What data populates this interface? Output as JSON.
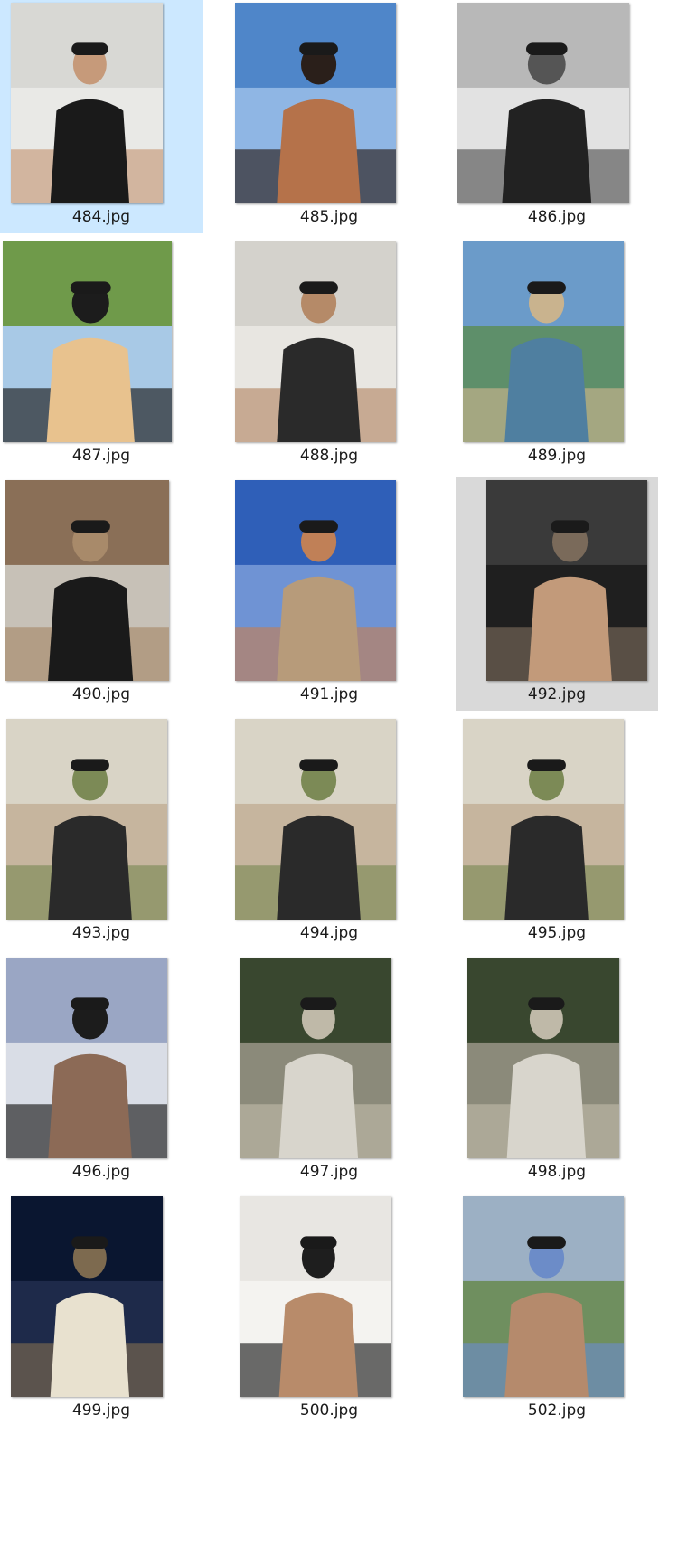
{
  "view": "large-icons",
  "selected_file": "484.jpg",
  "hovered_file": "492.jpg",
  "files": [
    {
      "name": "484.jpg",
      "scene": "mirror-selfie-black-tank",
      "palette": [
        "#d8d8d4",
        "#e9e9e6",
        "#1a1a1a",
        "#c69a7a"
      ]
    },
    {
      "name": "485.jpg",
      "scene": "shirtless-blue-sky",
      "palette": [
        "#4f86c9",
        "#8fb6e4",
        "#b5724a",
        "#2a1f1a"
      ]
    },
    {
      "name": "486.jpg",
      "scene": "bench-black-and-white",
      "palette": [
        "#b8b8b8",
        "#e2e2e2",
        "#222222",
        "#555555"
      ]
    },
    {
      "name": "487.jpg",
      "scene": "sunglasses-floral-shirt",
      "palette": [
        "#6f9a4a",
        "#a8c9e6",
        "#e8c28e",
        "#1c1c1c"
      ]
    },
    {
      "name": "488.jpg",
      "scene": "portrait-dark-blazer",
      "palette": [
        "#d4d2cc",
        "#e8e6e1",
        "#2a2a2a",
        "#b58a68"
      ]
    },
    {
      "name": "489.jpg",
      "scene": "retiro-park-lake",
      "palette": [
        "#6b9bc9",
        "#5e8f6a",
        "#4f7fa0",
        "#c9b38e"
      ]
    },
    {
      "name": "490.jpg",
      "scene": "mirror-selfie-chair",
      "palette": [
        "#8a6f57",
        "#c7c1b7",
        "#1a1a1a",
        "#a88a6a"
      ]
    },
    {
      "name": "491.jpg",
      "scene": "shirtless-desert-sky",
      "palette": [
        "#2f5fb8",
        "#6f93d4",
        "#b79b7a",
        "#c08057"
      ]
    },
    {
      "name": "492.jpg",
      "scene": "leather-jacket-portrait",
      "palette": [
        "#3a3a3a",
        "#1f1f1f",
        "#c29a7a",
        "#7a6a5a"
      ]
    },
    {
      "name": "493.jpg",
      "scene": "coat-wall-profile",
      "palette": [
        "#d9d4c6",
        "#c6b59e",
        "#2a2a2a",
        "#7c8a56"
      ]
    },
    {
      "name": "494.jpg",
      "scene": "coat-wall-profile",
      "palette": [
        "#d9d4c6",
        "#c6b59e",
        "#2a2a2a",
        "#7c8a56"
      ]
    },
    {
      "name": "495.jpg",
      "scene": "coat-wall-closeup",
      "palette": [
        "#d9d4c6",
        "#c6b59e",
        "#2a2a2a",
        "#7c8a56"
      ]
    },
    {
      "name": "496.jpg",
      "scene": "shirtless-dusk-palm",
      "palette": [
        "#9aa6c4",
        "#d9dde6",
        "#8c6a56",
        "#1c1c1c"
      ]
    },
    {
      "name": "497.jpg",
      "scene": "white-shirt-garden-path",
      "palette": [
        "#39472f",
        "#8b8a7a",
        "#d8d5cc",
        "#bfb9a8"
      ]
    },
    {
      "name": "498.jpg",
      "scene": "white-shirt-garden-path",
      "palette": [
        "#39472f",
        "#8b8a7a",
        "#d8d5cc",
        "#bfb9a8"
      ]
    },
    {
      "name": "499.jpg",
      "scene": "night-beach-moon",
      "palette": [
        "#0a1630",
        "#1e2a4a",
        "#e8e1cf",
        "#7d6a4f"
      ]
    },
    {
      "name": "500.jpg",
      "scene": "white-shirt-selfie-door",
      "palette": [
        "#e8e6e2",
        "#f4f3f0",
        "#b88b6a",
        "#1e1e1e"
      ]
    },
    {
      "name": "502.jpg",
      "scene": "striped-shirt-outdoor",
      "palette": [
        "#9cb0c4",
        "#6f8f5f",
        "#b58a6c",
        "#6c8cc8"
      ]
    }
  ]
}
